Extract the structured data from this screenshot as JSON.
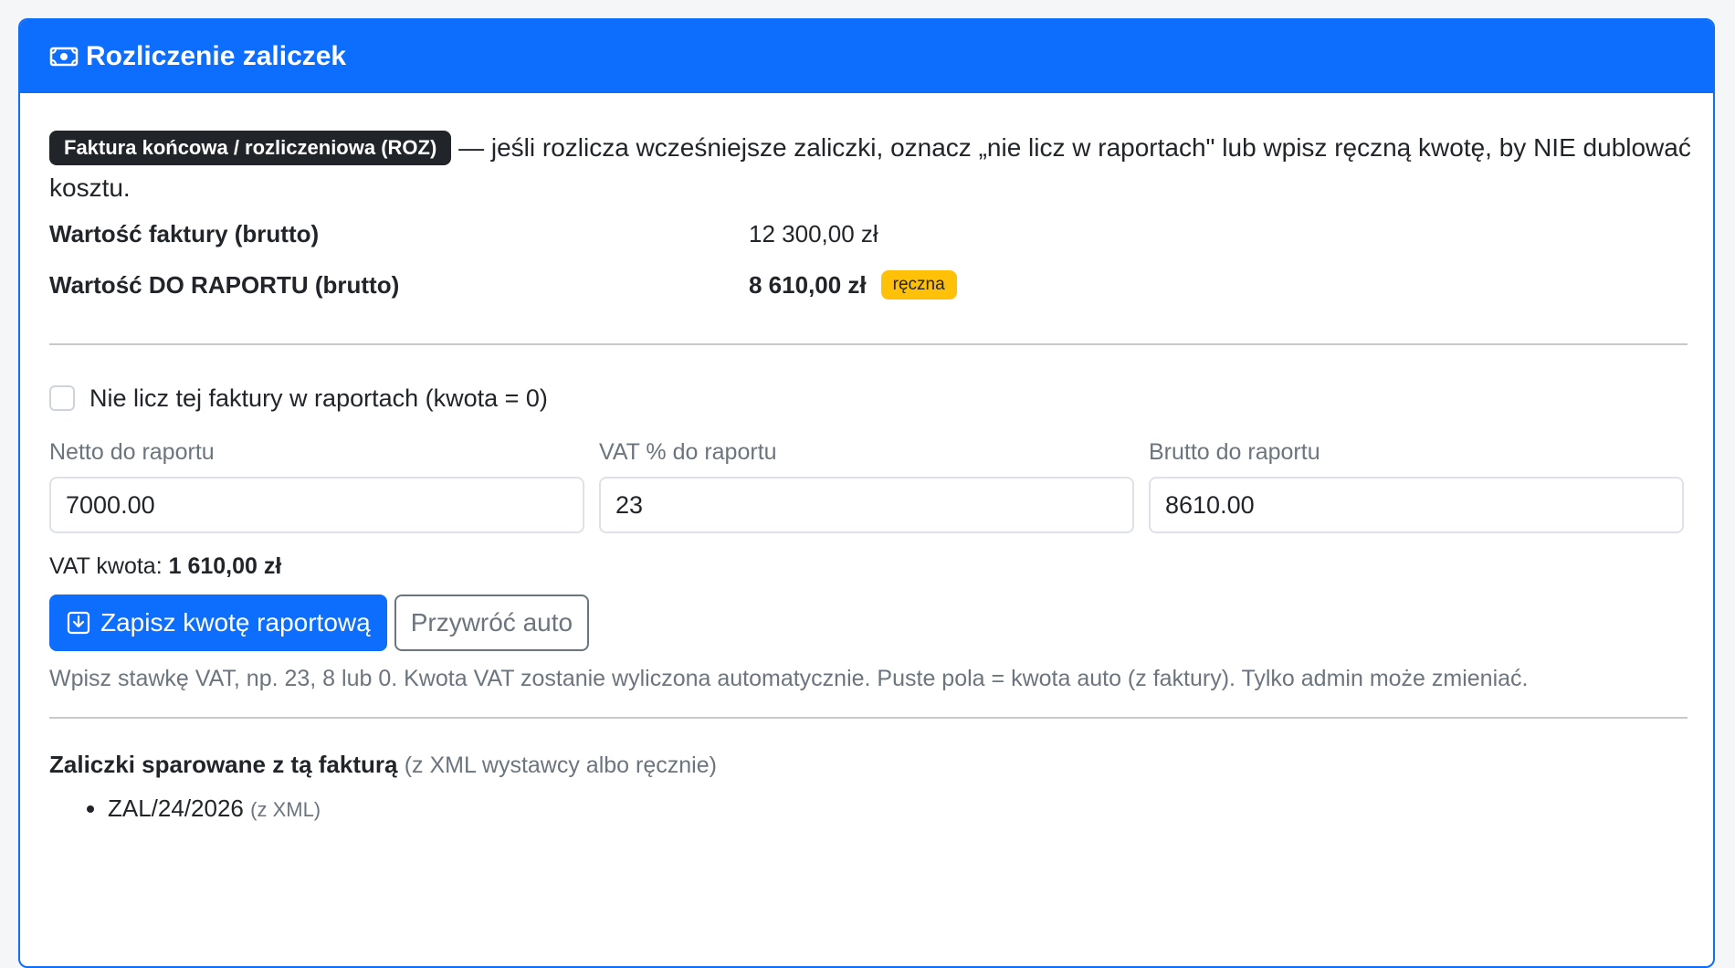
{
  "header": {
    "icon": "cash-icon",
    "title": "Rozliczenie zaliczek"
  },
  "intro": {
    "badge": "Faktura końcowa / rozliczeniowa (ROZ)",
    "text": "— jeśli rozlicza wcześniejsze zaliczki, oznacz „nie licz w raportach\" lub wpisz ręczną kwotę, by NIE dublować kosztu."
  },
  "summary": {
    "invoice_label": "Wartość faktury (brutto)",
    "invoice_value": "12 300,00 zł",
    "report_label": "Wartość DO RAPORTU (brutto)",
    "report_value": "8 610,00 zł",
    "report_badge": "ręczna"
  },
  "exclude": {
    "label": "Nie licz tej faktury w raportach (kwota = 0)",
    "checked": false
  },
  "fields": {
    "net_label": "Netto do raportu",
    "net_value": "7000.00",
    "vat_label": "VAT % do raportu",
    "vat_value": "23",
    "gross_label": "Brutto do raportu",
    "gross_value": "8610.00"
  },
  "vat_amount": {
    "label": "VAT kwota:",
    "value": "1 610,00 zł"
  },
  "buttons": {
    "save_label": "Zapisz kwotę raportową",
    "save_icon": "download-icon",
    "restore_label": "Przywróć auto"
  },
  "help_text": "Wpisz stawkę VAT, np. 23, 8 lub 0. Kwota VAT zostanie wyliczona automatycznie. Puste pola = kwota auto (z faktury). Tylko admin może zmieniać.",
  "linked": {
    "title": "Zaliczki sparowane z tą fakturą",
    "subtitle": "(z XML wystawcy albo ręcznie)",
    "items": [
      {
        "number": "ZAL/24/2026",
        "source": "(z XML)"
      }
    ]
  },
  "colors": {
    "primary": "#0d6efd",
    "warning": "#ffc107",
    "dark": "#212529",
    "muted": "#6c757d"
  }
}
